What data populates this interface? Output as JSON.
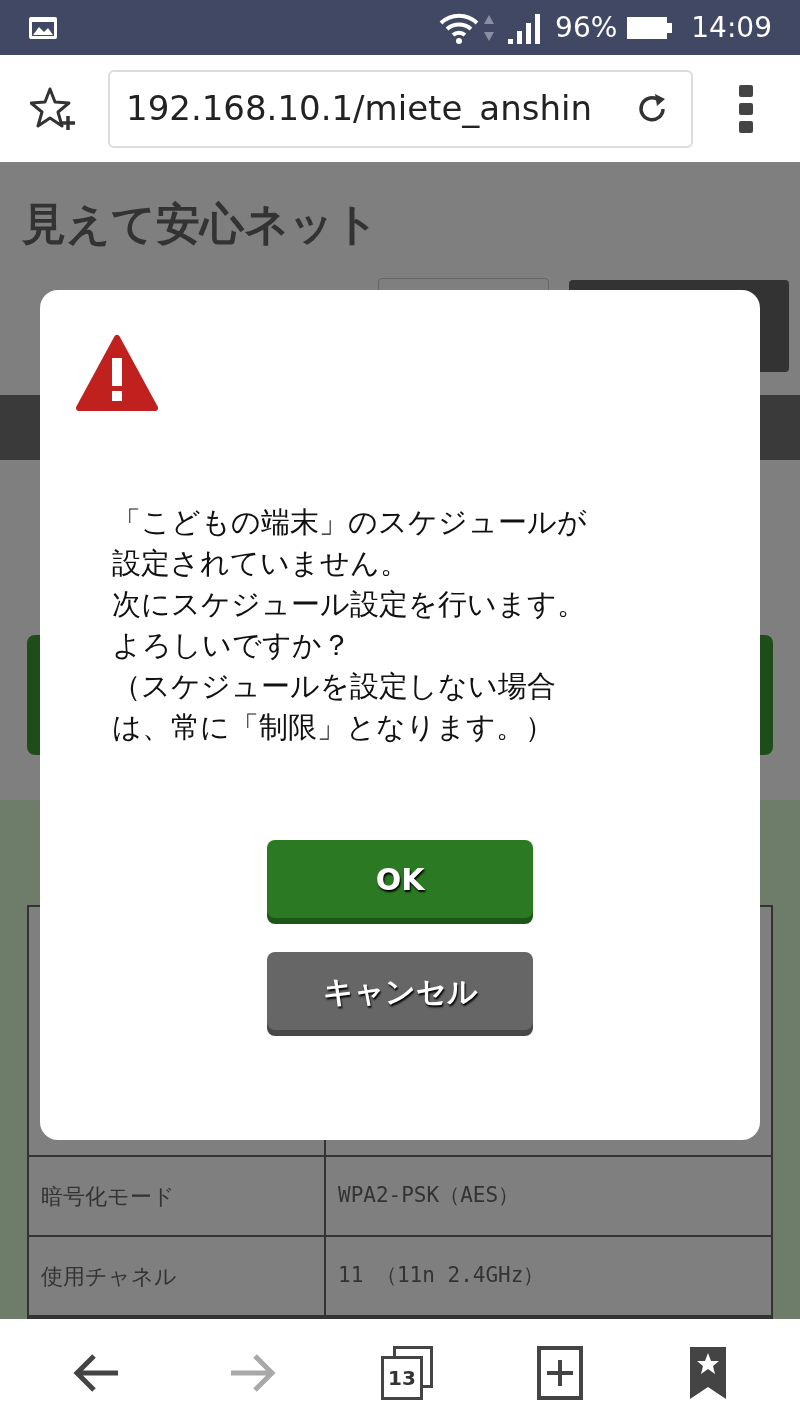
{
  "status_bar": {
    "battery": "96%",
    "time": "14:09"
  },
  "browser": {
    "url": "192.168.10.1/miete_anshin"
  },
  "page": {
    "title": "見えて安心ネット",
    "table_rows": [
      {
        "label": "暗号化モード",
        "value": "WPA2-PSK（AES）"
      },
      {
        "label": "使用チャネル",
        "value": "11 （11n 2.4GHz）"
      }
    ]
  },
  "dialog": {
    "message_lines": [
      "「こどもの端末」のスケジュールが",
      "設定されていません。",
      "次にスケジュール設定を行います。",
      "よろしいですか？",
      "（スケジュールを設定しない場合",
      "は、常に「制限」となります。）"
    ],
    "buttons": [
      {
        "label": "OK",
        "kind": "primary"
      },
      {
        "label": "キャンセル",
        "kind": "secondary"
      }
    ]
  },
  "bottom_bar": {
    "tab_count": "13",
    "forward_disabled": true
  }
}
